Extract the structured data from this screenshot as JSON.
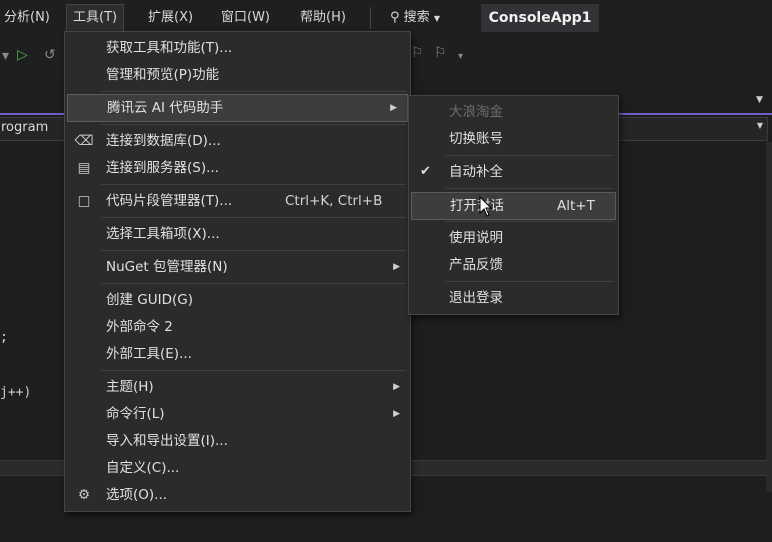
{
  "menubar": {
    "items": [
      "分析(N)",
      "工具(T)",
      "扩展(X)",
      "窗口(W)",
      "帮助(H)"
    ],
    "search_label": "搜索",
    "solution_name": "ConsoleApp1"
  },
  "editor": {
    "nav_label": "rogram",
    "code_fragments": [
      ";",
      "j++)"
    ]
  },
  "tools_menu": {
    "items": [
      {
        "label": "获取工具和功能(T)...",
        "icon": "",
        "shortcut": "",
        "submenu": false
      },
      {
        "label": "管理和预览(P)功能",
        "icon": "",
        "shortcut": "",
        "submenu": false
      },
      {
        "label": "腾讯云 AI 代码助手",
        "icon": "",
        "shortcut": "",
        "submenu": true
      },
      {
        "label": "连接到数据库(D)...",
        "icon": "database-connect-icon",
        "shortcut": "",
        "submenu": false
      },
      {
        "label": "连接到服务器(S)...",
        "icon": "server-connect-icon",
        "shortcut": "",
        "submenu": false
      },
      {
        "label": "代码片段管理器(T)...",
        "icon": "snippet-icon",
        "shortcut": "Ctrl+K, Ctrl+B",
        "submenu": false
      },
      {
        "label": "选择工具箱项(X)...",
        "icon": "",
        "shortcut": "",
        "submenu": false
      },
      {
        "label": "NuGet 包管理器(N)",
        "icon": "",
        "shortcut": "",
        "submenu": true
      },
      {
        "label": "创建 GUID(G)",
        "icon": "",
        "shortcut": "",
        "submenu": false
      },
      {
        "label": "外部命令 2",
        "icon": "",
        "shortcut": "",
        "submenu": false
      },
      {
        "label": "外部工具(E)...",
        "icon": "",
        "shortcut": "",
        "submenu": false
      },
      {
        "label": "主题(H)",
        "icon": "",
        "shortcut": "",
        "submenu": true
      },
      {
        "label": "命令行(L)",
        "icon": "",
        "shortcut": "",
        "submenu": true
      },
      {
        "label": "导入和导出设置(I)...",
        "icon": "",
        "shortcut": "",
        "submenu": false
      },
      {
        "label": "自定义(C)...",
        "icon": "",
        "shortcut": "",
        "submenu": false
      },
      {
        "label": "选项(O)...",
        "icon": "gear-icon",
        "shortcut": "",
        "submenu": false
      }
    ]
  },
  "ai_submenu": {
    "items": [
      {
        "label": "大浪淘金",
        "disabled": true,
        "checked": false,
        "shortcut": ""
      },
      {
        "label": "切换账号",
        "disabled": false,
        "checked": false,
        "shortcut": ""
      },
      {
        "label": "自动补全",
        "disabled": false,
        "checked": true,
        "shortcut": ""
      },
      {
        "label": "打开对话",
        "disabled": false,
        "checked": false,
        "shortcut": "Alt+T"
      },
      {
        "label": "使用说明",
        "disabled": false,
        "checked": false,
        "shortcut": ""
      },
      {
        "label": "产品反馈",
        "disabled": false,
        "checked": false,
        "shortcut": ""
      },
      {
        "label": "退出登录",
        "disabled": false,
        "checked": false,
        "shortcut": ""
      }
    ]
  },
  "colors": {
    "background": "#1f1f1f",
    "menu_bg": "#2b2b2b",
    "accent": "#6c5fc7",
    "hover": "#3d3d3d"
  }
}
